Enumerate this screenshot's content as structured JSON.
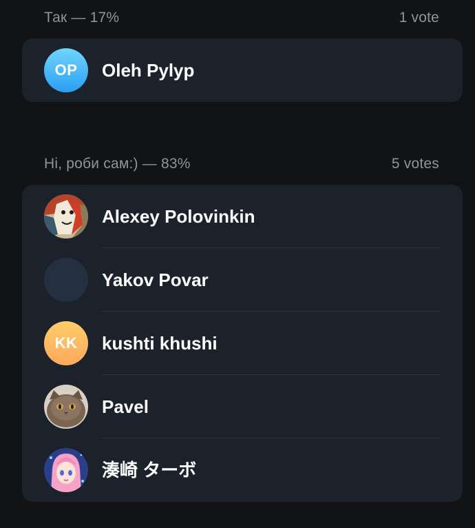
{
  "options": [
    {
      "label": "Так — 17%",
      "votes": "1 vote",
      "voters": [
        {
          "name": "Oleh Pylyp",
          "initials": "OP",
          "avatar": "initials-blue"
        }
      ]
    },
    {
      "label": "Ні, роби сам:) — 83%",
      "votes": "5 votes",
      "voters": [
        {
          "name": "Alexey Polovinkin",
          "initials": "",
          "avatar": "photo-art"
        },
        {
          "name": "Yakov Povar",
          "initials": "",
          "avatar": "empty"
        },
        {
          "name": "kushti khushi",
          "initials": "KK",
          "avatar": "initials-orange"
        },
        {
          "name": "Pavel",
          "initials": "",
          "avatar": "photo-cat"
        },
        {
          "name": "湊崎 ターボ",
          "initials": "",
          "avatar": "photo-anime"
        }
      ]
    }
  ],
  "colors": {
    "background": "#111315",
    "card": "#1b222b",
    "muted_text": "#8e959e",
    "divider": "#2a333d"
  }
}
